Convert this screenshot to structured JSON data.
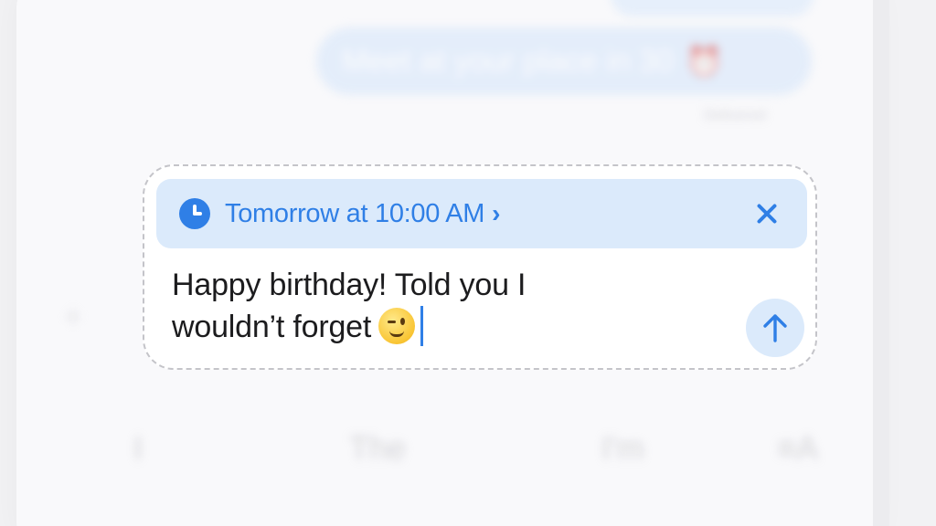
{
  "conversation": {
    "previous_message": "Meet at your place in 30",
    "previous_message_emoji": "⏰",
    "delivery_status": "Delivered"
  },
  "compose": {
    "schedule_label": "Tomorrow at 10:00 AM",
    "schedule_chevron": "›",
    "schedule_icon": "clock-icon",
    "close_icon": "close-icon",
    "message_line1": "Happy birthday! Told you I",
    "message_line2": "wouldn’t forget",
    "message_emoji": "wink-emoji",
    "send_icon": "arrow-up-icon"
  },
  "keyboard": {
    "suggestions": [
      "I",
      "The",
      "I'm"
    ],
    "format_icon": "text-format-icon"
  },
  "colors": {
    "accent": "#2f7fe6",
    "chip_background": "#dbeafb",
    "text": "#1c1c1e"
  }
}
